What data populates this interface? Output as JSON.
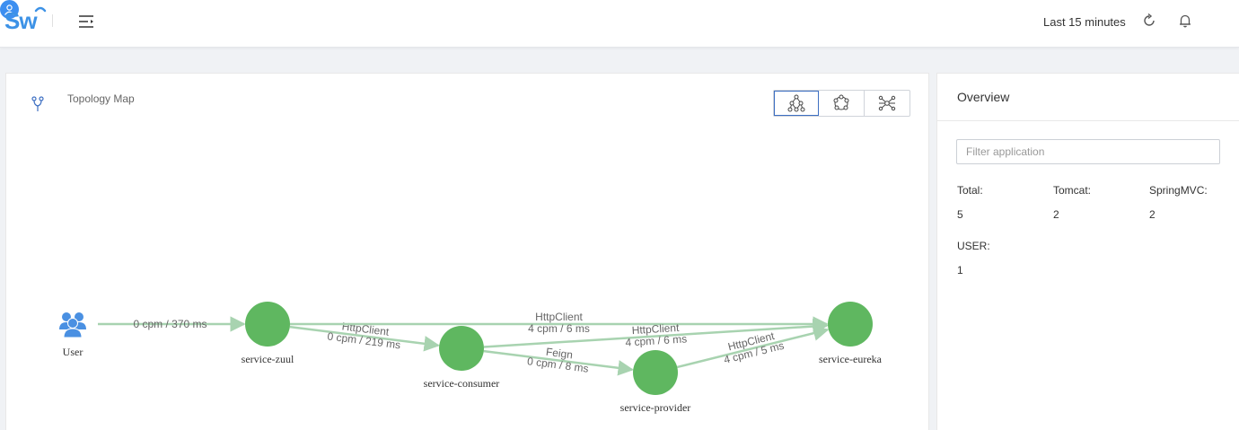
{
  "header": {
    "logo_text": "Sw",
    "time_range": "Last 15 minutes",
    "icons": [
      "menu-toggle-icon",
      "reload-icon",
      "bell-icon",
      "user-icon"
    ],
    "accent_color": "#3d92e6"
  },
  "topology": {
    "title": "Topology Map",
    "views": [
      {
        "name": "graph-view",
        "active": true
      },
      {
        "name": "circle-view",
        "active": false
      },
      {
        "name": "radial-view",
        "active": false
      }
    ],
    "node_color": "#5fb760",
    "edge_color": "#a8d3b0",
    "nodes": [
      {
        "id": "user",
        "label": "User",
        "type": "USER"
      },
      {
        "id": "zuul",
        "label": "service-zuul",
        "type": "service"
      },
      {
        "id": "consumer",
        "label": "service-consumer",
        "type": "service"
      },
      {
        "id": "provider",
        "label": "service-provider",
        "type": "service"
      },
      {
        "id": "eureka",
        "label": "service-eureka",
        "type": "service"
      }
    ],
    "edges": [
      {
        "from": "user",
        "to": "zuul",
        "component": "",
        "metric": "0 cpm / 370 ms"
      },
      {
        "from": "zuul",
        "to": "consumer",
        "component": "HttpClient",
        "metric": "0 cpm / 219 ms"
      },
      {
        "from": "zuul",
        "to": "eureka",
        "component": "HttpClient",
        "metric": "4 cpm / 6 ms"
      },
      {
        "from": "consumer",
        "to": "eureka",
        "component": "HttpClient",
        "metric": "4 cpm / 6 ms"
      },
      {
        "from": "consumer",
        "to": "provider",
        "component": "Feign",
        "metric": "0 cpm / 8 ms"
      },
      {
        "from": "provider",
        "to": "eureka",
        "component": "HttpClient",
        "metric": "4 cpm / 5 ms"
      }
    ]
  },
  "overview": {
    "title": "Overview",
    "filter_placeholder": "Filter application",
    "filter_value": "",
    "stats": [
      {
        "label": "Total:",
        "value": "5"
      },
      {
        "label": "Tomcat:",
        "value": "2"
      },
      {
        "label": "SpringMVC:",
        "value": "2"
      },
      {
        "label": "USER:",
        "value": "1"
      }
    ]
  }
}
